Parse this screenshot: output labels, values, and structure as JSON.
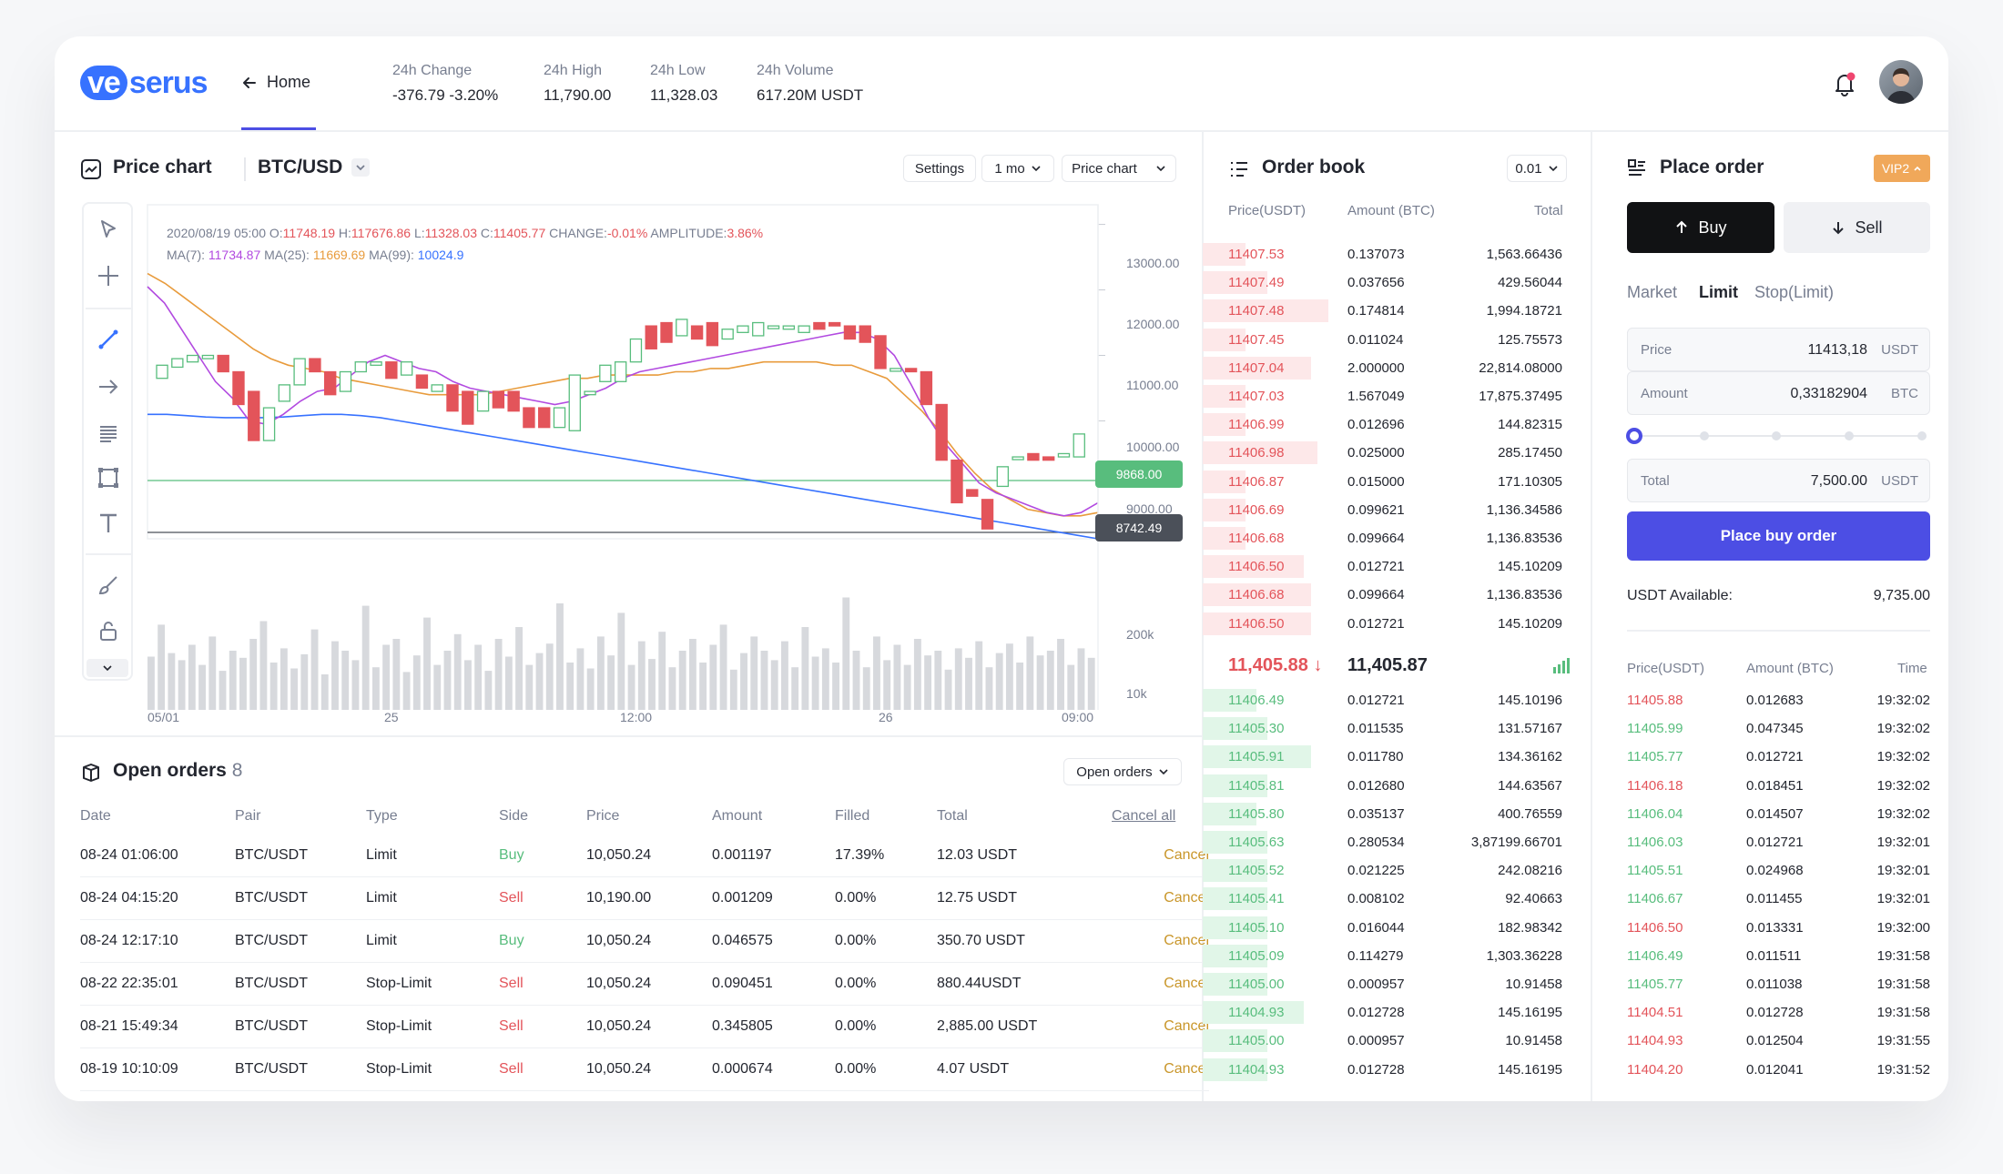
{
  "brand": {
    "logo_pill": "ve",
    "logo_rest": "serus",
    "accent": "#4c4ee4"
  },
  "nav": {
    "home": "Home"
  },
  "stats": [
    {
      "label": "24h Change",
      "value": "-376.79 -3.20%"
    },
    {
      "label": "24h High",
      "value": "11,790.00"
    },
    {
      "label": "24h Low",
      "value": "11,328.03"
    },
    {
      "label": "24h Volume",
      "value": "617.20M USDT"
    }
  ],
  "chart_panel": {
    "title": "Price chart",
    "pair": "BTC/USD",
    "settings": "Settings",
    "interval": "1 mo",
    "view": "Price chart",
    "ohlc": {
      "date": "2020/08/19 05:00",
      "o_label": "O:",
      "o": "11748.19",
      "h_label": "H:",
      "h": "117676.86",
      "l_label": "L:",
      "l": "11328.03",
      "c_label": "C:",
      "c": "11405.77",
      "change_label": "CHANGE:",
      "change": "-0.01%",
      "amp_label": "AMPLITUDE:",
      "amp": "3.86%"
    },
    "ma": {
      "ma7_label": "MA(7):",
      "ma7": "11734.87",
      "ma25_label": "MA(25):",
      "ma25": "11669.69",
      "ma99_label": "MA(99):",
      "ma99": "10024.9"
    },
    "price_axis": [
      "13000.00",
      "12000.00",
      "11000.00",
      "10000.00",
      "9000.00"
    ],
    "green_tag": "9868.00",
    "dark_tag": "8742.49",
    "volume_axis": [
      "200k",
      "10k"
    ],
    "time_axis": [
      "05/01",
      "25",
      "12:00",
      "26",
      "09:00"
    ]
  },
  "chart_data": {
    "type": "candlestick",
    "ylim": [
      8200,
      13300
    ],
    "candles": [
      {
        "o": 10650,
        "c": 10850
      },
      {
        "o": 10820,
        "c": 10950
      },
      {
        "o": 10900,
        "c": 11000
      },
      {
        "o": 10950,
        "c": 11000
      },
      {
        "o": 11000,
        "c": 10750
      },
      {
        "o": 10750,
        "c": 10250
      },
      {
        "o": 10450,
        "c": 9700
      },
      {
        "o": 9700,
        "c": 10200
      },
      {
        "o": 10300,
        "c": 10550
      },
      {
        "o": 10550,
        "c": 10950
      },
      {
        "o": 10950,
        "c": 10750
      },
      {
        "o": 10750,
        "c": 10400
      },
      {
        "o": 10450,
        "c": 10750
      },
      {
        "o": 10750,
        "c": 10900
      },
      {
        "o": 10850,
        "c": 10900
      },
      {
        "o": 10900,
        "c": 10650
      },
      {
        "o": 10700,
        "c": 10900
      },
      {
        "o": 10700,
        "c": 10500
      },
      {
        "o": 10450,
        "c": 10550
      },
      {
        "o": 10550,
        "c": 10150
      },
      {
        "o": 10450,
        "c": 9950
      },
      {
        "o": 10150,
        "c": 10450
      },
      {
        "o": 10450,
        "c": 10200
      },
      {
        "o": 10450,
        "c": 10150
      },
      {
        "o": 10200,
        "c": 9900
      },
      {
        "o": 10200,
        "c": 9900
      },
      {
        "o": 9900,
        "c": 10200
      },
      {
        "o": 9850,
        "c": 10700
      },
      {
        "o": 10400,
        "c": 10450
      },
      {
        "o": 10600,
        "c": 10850
      },
      {
        "o": 10600,
        "c": 10900
      },
      {
        "o": 10900,
        "c": 11250
      },
      {
        "o": 11450,
        "c": 11100
      },
      {
        "o": 11500,
        "c": 11200
      },
      {
        "o": 11300,
        "c": 11550
      },
      {
        "o": 11450,
        "c": 11250
      },
      {
        "o": 11500,
        "c": 11150
      },
      {
        "o": 11250,
        "c": 11400
      },
      {
        "o": 11350,
        "c": 11450
      },
      {
        "o": 11300,
        "c": 11500
      },
      {
        "o": 11450,
        "c": 11450
      },
      {
        "o": 11400,
        "c": 11450
      },
      {
        "o": 11350,
        "c": 11450
      },
      {
        "o": 11500,
        "c": 11400
      },
      {
        "o": 11500,
        "c": 11450
      },
      {
        "o": 11450,
        "c": 11250
      },
      {
        "o": 11450,
        "c": 11200
      },
      {
        "o": 11300,
        "c": 10800
      },
      {
        "o": 10800,
        "c": 10800
      },
      {
        "o": 10800,
        "c": 10750
      },
      {
        "o": 10750,
        "c": 10250
      },
      {
        "o": 10250,
        "c": 9400
      },
      {
        "o": 9400,
        "c": 8750
      },
      {
        "o": 8950,
        "c": 8850
      },
      {
        "o": 8800,
        "c": 8350
      },
      {
        "o": 9000,
        "c": 9300
      },
      {
        "o": 9450,
        "c": 9450
      },
      {
        "o": 9500,
        "c": 9400
      },
      {
        "o": 9450,
        "c": 9400
      },
      {
        "o": 9450,
        "c": 9500
      },
      {
        "o": 9450,
        "c": 9800
      }
    ],
    "ma7": [
      12050,
      11800,
      11400,
      11000,
      10600,
      10350,
      10000,
      9950,
      10100,
      10300,
      10450,
      10500,
      10700,
      10900,
      11000,
      10900,
      10800,
      10750,
      10600,
      10500,
      10450,
      10400,
      10350,
      10300,
      10250,
      10300,
      10400,
      10500,
      10650,
      10750,
      10800,
      10850,
      10900,
      10950,
      11000,
      11050,
      11100,
      11150,
      11200,
      11250,
      11300,
      11350,
      11350,
      11250,
      11000,
      10550,
      10050,
      9650,
      9350,
      9050,
      8900,
      8800,
      8700,
      8600,
      8550,
      8600,
      8750
    ],
    "ma25": [
      12250,
      12100,
      11900,
      11700,
      11500,
      11300,
      11100,
      10950,
      10850,
      10800,
      10750,
      10650,
      10600,
      10550,
      10500,
      10450,
      10400,
      10400,
      10400,
      10400,
      10450,
      10500,
      10550,
      10600,
      10650,
      10650,
      10700,
      10700,
      10700,
      10700,
      10750,
      10750,
      10800,
      10800,
      10850,
      10900,
      10900,
      10900,
      10900,
      10850,
      10850,
      10750,
      10650,
      10400,
      10150,
      9850,
      9500,
      9200,
      8950,
      8800,
      8650,
      8600,
      8550,
      8550,
      8600
    ],
    "ma99": [
      10100,
      10100,
      10080,
      10060,
      10050,
      10050,
      10050,
      10060,
      10080,
      10100,
      10100,
      10080,
      10050,
      10000,
      9950,
      9900,
      9850,
      9800,
      9750,
      9700,
      9650,
      9600,
      9550,
      9500,
      9450,
      9400,
      9350,
      9300,
      9250,
      9200,
      9150,
      9100,
      9050,
      9000,
      8950,
      8900,
      8850,
      8800,
      8750,
      8700,
      8650,
      8600,
      8550,
      8500,
      8450,
      8400,
      8350,
      8300,
      8250,
      8200
    ],
    "volume": [
      0.45,
      0.72,
      0.48,
      0.42,
      0.55,
      0.38,
      0.62,
      0.33,
      0.5,
      0.44,
      0.6,
      0.75,
      0.4,
      0.52,
      0.35,
      0.47,
      0.68,
      0.3,
      0.58,
      0.5,
      0.42,
      0.88,
      0.36,
      0.55,
      0.6,
      0.32,
      0.46,
      0.78,
      0.38,
      0.5,
      0.64,
      0.42,
      0.55,
      0.33,
      0.6,
      0.45,
      0.7,
      0.38,
      0.48,
      0.56,
      0.9,
      0.4,
      0.52,
      0.35,
      0.62,
      0.46,
      0.82,
      0.38,
      0.58,
      0.43,
      0.66,
      0.36,
      0.5,
      0.6,
      0.4,
      0.55,
      0.72,
      0.34,
      0.48,
      0.62,
      0.5,
      0.42,
      0.58,
      0.36,
      0.7,
      0.45,
      0.52,
      0.4,
      0.95,
      0.5,
      0.36,
      0.62,
      0.42,
      0.55,
      0.38,
      0.6,
      0.46,
      0.5,
      0.34,
      0.52,
      0.44,
      0.58,
      0.36,
      0.48,
      0.56,
      0.4,
      0.62,
      0.46,
      0.5,
      0.6,
      0.38,
      0.52,
      0.44
    ]
  },
  "open_orders": {
    "title": "Open orders",
    "count": "8",
    "filter": "Open orders",
    "columns": [
      "Date",
      "Pair",
      "Type",
      "Side",
      "Price",
      "Amount",
      "Filled",
      "Total"
    ],
    "cancel_all": "Cancel all",
    "cancel_label": "Cancel",
    "rows": [
      {
        "date": "08-24 01:06:00",
        "pair": "BTC/USDT",
        "type": "Limit",
        "side": "Buy",
        "price": "10,050.24",
        "amount": "0.001197",
        "filled": "17.39%",
        "total": "12.03 USDT"
      },
      {
        "date": "08-24 04:15:20",
        "pair": "BTC/USDT",
        "type": "Limit",
        "side": "Sell",
        "price": "10,190.00",
        "amount": "0.001209",
        "filled": "0.00%",
        "total": "12.75 USDT"
      },
      {
        "date": "08-24 12:17:10",
        "pair": "BTC/USDT",
        "type": "Limit",
        "side": "Buy",
        "price": "10,050.24",
        "amount": "0.046575",
        "filled": "0.00%",
        "total": "350.70 USDT"
      },
      {
        "date": "08-22 22:35:01",
        "pair": "BTC/USDT",
        "type": "Stop-Limit",
        "side": "Sell",
        "price": "10,050.24",
        "amount": "0.090451",
        "filled": "0.00%",
        "total": "880.44USDT"
      },
      {
        "date": "08-21 15:49:34",
        "pair": "BTC/USDT",
        "type": "Stop-Limit",
        "side": "Sell",
        "price": "10,050.24",
        "amount": "0.345805",
        "filled": "0.00%",
        "total": "2,885.00 USDT"
      },
      {
        "date": "08-19 10:10:09",
        "pair": "BTC/USDT",
        "type": "Stop-Limit",
        "side": "Sell",
        "price": "10,050.24",
        "amount": "0.000674",
        "filled": "0.00%",
        "total": "4.07 USDT"
      }
    ]
  },
  "order_book": {
    "title": "Order book",
    "precision": "0.01",
    "columns": [
      "Price(USDT)",
      "Amount (BTC)",
      "Total"
    ],
    "asks": [
      {
        "p": "11407.53",
        "a": "0.137073",
        "t": "1,563.66436",
        "depth": 0.12
      },
      {
        "p": "11407.49",
        "a": "0.037656",
        "t": "429.56044",
        "depth": 0.18
      },
      {
        "p": "11407.48",
        "a": "0.174814",
        "t": "1,994.18721",
        "depth": 0.35
      },
      {
        "p": "11407.45",
        "a": "0.011024",
        "t": "125.75573",
        "depth": 0.12
      },
      {
        "p": "11407.04",
        "a": "2.000000",
        "t": "22,814.08000",
        "depth": 0.3
      },
      {
        "p": "11407.03",
        "a": "1.567049",
        "t": "17,875.37495",
        "depth": 0.12
      },
      {
        "p": "11406.99",
        "a": "0.012696",
        "t": "144.82315",
        "depth": 0.12
      },
      {
        "p": "11406.98",
        "a": "0.025000",
        "t": "285.17450",
        "depth": 0.32
      },
      {
        "p": "11406.87",
        "a": "0.015000",
        "t": "171.10305",
        "depth": 0.12
      },
      {
        "p": "11406.69",
        "a": "0.099621",
        "t": "1,136.34586",
        "depth": 0.12
      },
      {
        "p": "11406.68",
        "a": "0.099664",
        "t": "1,136.83536",
        "depth": 0.12
      },
      {
        "p": "11406.50",
        "a": "0.012721",
        "t": "145.10209",
        "depth": 0.28
      },
      {
        "p": "11406.68",
        "a": "0.099664",
        "t": "1,136.83536",
        "depth": 0.3
      },
      {
        "p": "11406.50",
        "a": "0.012721",
        "t": "145.10209",
        "depth": 0.3
      }
    ],
    "last_price": "11,405.88",
    "last_arrow": "↓",
    "index_price": "11,405.87",
    "bids": [
      {
        "p": "11406.49",
        "a": "0.012721",
        "t": "145.10196",
        "depth": 0.15
      },
      {
        "p": "11405.30",
        "a": "0.011535",
        "t": "131.57167",
        "depth": 0.18
      },
      {
        "p": "11405.91",
        "a": "0.011780",
        "t": "134.36162",
        "depth": 0.3
      },
      {
        "p": "11405.81",
        "a": "0.012680",
        "t": "144.63567",
        "depth": 0.18
      },
      {
        "p": "11405.80",
        "a": "0.035137",
        "t": "400.76559",
        "depth": 0.15
      },
      {
        "p": "11405.63",
        "a": "0.280534",
        "t": "3,87199.66701",
        "depth": 0.18
      },
      {
        "p": "11405.52",
        "a": "0.021225",
        "t": "242.08216",
        "depth": 0.18
      },
      {
        "p": "11405.41",
        "a": "0.008102",
        "t": "92.40663",
        "depth": 0.18
      },
      {
        "p": "11405.10",
        "a": "0.016044",
        "t": "182.98342",
        "depth": 0.18
      },
      {
        "p": "11405.09",
        "a": "0.114279",
        "t": "1,303.36228",
        "depth": 0.18
      },
      {
        "p": "11405.00",
        "a": "0.000957",
        "t": "10.91458",
        "depth": 0.18
      },
      {
        "p": "11404.93",
        "a": "0.012728",
        "t": "145.16195",
        "depth": 0.28
      },
      {
        "p": "11405.00",
        "a": "0.000957",
        "t": "10.91458",
        "depth": 0.18
      },
      {
        "p": "11404.93",
        "a": "0.012728",
        "t": "145.16195",
        "depth": 0.18
      }
    ]
  },
  "place_order": {
    "title": "Place order",
    "vip": "VIP2",
    "buy": "Buy",
    "sell": "Sell",
    "tabs": [
      "Market",
      "Limit",
      "Stop(Limit)"
    ],
    "price_label": "Price",
    "price_value": "11413,18",
    "price_unit": "USDT",
    "amount_label": "Amount",
    "amount_value": "0,33182904",
    "amount_unit": "BTC",
    "slider_value": 0,
    "total_label": "Total",
    "total_value": "7,500.00",
    "total_unit": "USDT",
    "submit": "Place buy order",
    "avail_label": "USDT Available:",
    "avail_value": "9,735.00"
  },
  "trades": {
    "columns": [
      "Price(USDT)",
      "Amount (BTC)",
      "Time"
    ],
    "rows": [
      {
        "p": "11405.88",
        "a": "0.012683",
        "t": "19:32:02",
        "side": "sell"
      },
      {
        "p": "11405.99",
        "a": "0.047345",
        "t": "19:32:02",
        "side": "buy"
      },
      {
        "p": "11405.77",
        "a": "0.012721",
        "t": "19:32:02",
        "side": "buy"
      },
      {
        "p": "11406.18",
        "a": "0.018451",
        "t": "19:32:02",
        "side": "sell"
      },
      {
        "p": "11406.04",
        "a": "0.014507",
        "t": "19:32:02",
        "side": "buy"
      },
      {
        "p": "11406.03",
        "a": "0.012721",
        "t": "19:32:01",
        "side": "buy"
      },
      {
        "p": "11405.51",
        "a": "0.024968",
        "t": "19:32:01",
        "side": "buy"
      },
      {
        "p": "11406.67",
        "a": "0.011455",
        "t": "19:32:01",
        "side": "buy"
      },
      {
        "p": "11406.50",
        "a": "0.013331",
        "t": "19:32:00",
        "side": "sell"
      },
      {
        "p": "11406.49",
        "a": "0.011511",
        "t": "19:31:58",
        "side": "buy"
      },
      {
        "p": "11405.77",
        "a": "0.011038",
        "t": "19:31:58",
        "side": "buy"
      },
      {
        "p": "11404.51",
        "a": "0.012728",
        "t": "19:31:58",
        "side": "sell"
      },
      {
        "p": "11404.93",
        "a": "0.012504",
        "t": "19:31:55",
        "side": "sell"
      },
      {
        "p": "11404.20",
        "a": "0.012041",
        "t": "19:31:52",
        "side": "sell"
      }
    ]
  }
}
